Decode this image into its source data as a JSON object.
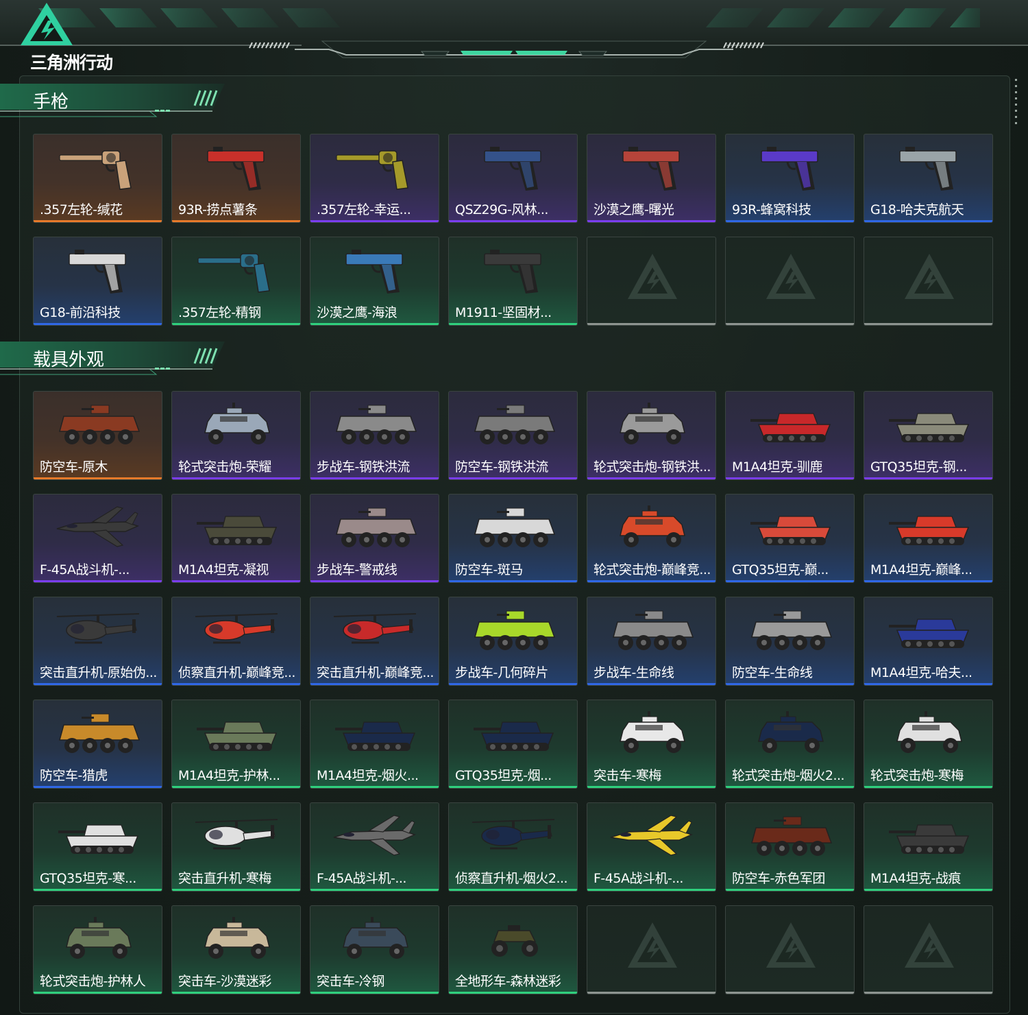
{
  "brand": {
    "logo_text": "三角洲行动"
  },
  "sections": {
    "pistols": {
      "title": "手枪",
      "items": [
        {
          "label": ".357左轮-缄花",
          "rarity": "orange",
          "kind": "revolver",
          "color": "#c9a27a"
        },
        {
          "label": "93R-捞点薯条",
          "rarity": "orange",
          "kind": "pistol",
          "color": "#c8302a"
        },
        {
          "label": ".357左轮-幸运...",
          "rarity": "purple",
          "kind": "revolver",
          "color": "#a59a2a"
        },
        {
          "label": "QSZ29G-风林...",
          "rarity": "purple",
          "kind": "pistol",
          "color": "#34528a"
        },
        {
          "label": "沙漠之鹰-曙光",
          "rarity": "purple",
          "kind": "pistol",
          "color": "#b5443a"
        },
        {
          "label": "93R-蜂窝科技",
          "rarity": "blue",
          "kind": "pistol",
          "color": "#5a3ac8"
        },
        {
          "label": "G18-哈夫克航天",
          "rarity": "blue",
          "kind": "pistol",
          "color": "#9aa4a8"
        },
        {
          "label": "G18-前沿科技",
          "rarity": "blue",
          "kind": "pistol",
          "color": "#d8d8d8"
        },
        {
          "label": ".357左轮-精钢",
          "rarity": "green",
          "kind": "revolver",
          "color": "#2a6e8a"
        },
        {
          "label": "沙漠之鹰-海浪",
          "rarity": "green",
          "kind": "pistol",
          "color": "#3a7ab8"
        },
        {
          "label": "M1911-坚固材...",
          "rarity": "green",
          "kind": "pistol",
          "color": "#3a3a3a"
        },
        {
          "label": "",
          "rarity": "empty",
          "kind": "empty",
          "color": ""
        },
        {
          "label": "",
          "rarity": "empty",
          "kind": "empty",
          "color": ""
        },
        {
          "label": "",
          "rarity": "empty",
          "kind": "empty",
          "color": ""
        }
      ]
    },
    "vehicles": {
      "title": "载具外观",
      "items": [
        {
          "label": "防空车-原木",
          "rarity": "orange",
          "kind": "apc",
          "color": "#8a3a22"
        },
        {
          "label": "轮式突击炮-荣耀",
          "rarity": "purple",
          "kind": "car",
          "color": "#9aa8b8"
        },
        {
          "label": "步战车-钢铁洪流",
          "rarity": "purple",
          "kind": "apc",
          "color": "#8a8a8a"
        },
        {
          "label": "防空车-钢铁洪流",
          "rarity": "purple",
          "kind": "apc",
          "color": "#7a7a7a"
        },
        {
          "label": "轮式突击炮-钢铁洪...",
          "rarity": "purple",
          "kind": "car",
          "color": "#9a9a9a"
        },
        {
          "label": "M1A4坦克-驯鹿",
          "rarity": "purple",
          "kind": "tank",
          "color": "#c8282a"
        },
        {
          "label": "GTQ35坦克-钢...",
          "rarity": "purple",
          "kind": "tank",
          "color": "#8a8a7a"
        },
        {
          "label": "F-45A战斗机-...",
          "rarity": "purple",
          "kind": "jet",
          "color": "#3a3a3a"
        },
        {
          "label": "M1A4坦克-凝视",
          "rarity": "purple",
          "kind": "tank",
          "color": "#4a4a3a"
        },
        {
          "label": "步战车-警戒线",
          "rarity": "purple",
          "kind": "apc",
          "color": "#9a8a8a"
        },
        {
          "label": "防空车-斑马",
          "rarity": "blue",
          "kind": "apc",
          "color": "#d8d8d8"
        },
        {
          "label": "轮式突击炮-巅峰竞...",
          "rarity": "blue",
          "kind": "car",
          "color": "#d84a2a"
        },
        {
          "label": "GTQ35坦克-巅...",
          "rarity": "blue",
          "kind": "tank",
          "color": "#d84a3a"
        },
        {
          "label": "M1A4坦克-巅峰...",
          "rarity": "blue",
          "kind": "tank",
          "color": "#d83a2a"
        },
        {
          "label": "突击直升机-原始伪...",
          "rarity": "blue",
          "kind": "heli",
          "color": "#3a3a3a"
        },
        {
          "label": "侦察直升机-巅峰竞...",
          "rarity": "blue",
          "kind": "heli",
          "color": "#d83a2a"
        },
        {
          "label": "突击直升机-巅峰竞...",
          "rarity": "blue",
          "kind": "heli",
          "color": "#c82a2a"
        },
        {
          "label": "步战车-几何碎片",
          "rarity": "blue",
          "kind": "apc",
          "color": "#a8d82a"
        },
        {
          "label": "步战车-生命线",
          "rarity": "blue",
          "kind": "apc",
          "color": "#8a8a8a"
        },
        {
          "label": "防空车-生命线",
          "rarity": "blue",
          "kind": "apc",
          "color": "#9a9a9a"
        },
        {
          "label": "M1A4坦克-哈夫...",
          "rarity": "blue",
          "kind": "tank",
          "color": "#2a3a9a"
        },
        {
          "label": "防空车-猎虎",
          "rarity": "blue",
          "kind": "apc",
          "color": "#c88a2a"
        },
        {
          "label": "M1A4坦克-护林...",
          "rarity": "green",
          "kind": "tank",
          "color": "#6a7a5a"
        },
        {
          "label": "M1A4坦克-烟火...",
          "rarity": "green",
          "kind": "tank",
          "color": "#1a2a4a"
        },
        {
          "label": "GTQ35坦克-烟...",
          "rarity": "green",
          "kind": "tank",
          "color": "#1a2a4a"
        },
        {
          "label": "突击车-寒梅",
          "rarity": "green",
          "kind": "car",
          "color": "#e8e8e8"
        },
        {
          "label": "轮式突击炮-烟火2...",
          "rarity": "green",
          "kind": "car",
          "color": "#1a2a4a"
        },
        {
          "label": "轮式突击炮-寒梅",
          "rarity": "green",
          "kind": "car",
          "color": "#e0e0e0"
        },
        {
          "label": "GTQ35坦克-寒...",
          "rarity": "green",
          "kind": "tank",
          "color": "#e0e0e0"
        },
        {
          "label": "突击直升机-寒梅",
          "rarity": "green",
          "kind": "heli",
          "color": "#e0e0e0"
        },
        {
          "label": "F-45A战斗机-...",
          "rarity": "green",
          "kind": "jet",
          "color": "#6a6a6a"
        },
        {
          "label": "侦察直升机-烟火2...",
          "rarity": "green",
          "kind": "heli",
          "color": "#1a2a4a"
        },
        {
          "label": "F-45A战斗机-...",
          "rarity": "green",
          "kind": "jet",
          "color": "#e8c82a"
        },
        {
          "label": "防空车-赤色军团",
          "rarity": "green",
          "kind": "apc",
          "color": "#6a2a1a"
        },
        {
          "label": "M1A4坦克-战痕",
          "rarity": "green",
          "kind": "tank",
          "color": "#3a3a3a"
        },
        {
          "label": "轮式突击炮-护林人",
          "rarity": "green",
          "kind": "car",
          "color": "#6a7a5a"
        },
        {
          "label": "突击车-沙漠迷彩",
          "rarity": "green",
          "kind": "car",
          "color": "#c8b89a"
        },
        {
          "label": "突击车-冷钢",
          "rarity": "green",
          "kind": "car",
          "color": "#3a4a5a"
        },
        {
          "label": "全地形车-森林迷彩",
          "rarity": "green",
          "kind": "atv",
          "color": "#4a4a2a"
        },
        {
          "label": "",
          "rarity": "empty",
          "kind": "empty",
          "color": ""
        },
        {
          "label": "",
          "rarity": "empty",
          "kind": "empty",
          "color": ""
        },
        {
          "label": "",
          "rarity": "empty",
          "kind": "empty",
          "color": ""
        }
      ]
    }
  },
  "colors": {
    "accent_green": "#2fd07d",
    "rarity_orange": "#e77a2a",
    "rarity_purple": "#7a3df0",
    "rarity_blue": "#2f67e6",
    "rarity_green": "#2fd07d",
    "empty": "#8d9490"
  }
}
